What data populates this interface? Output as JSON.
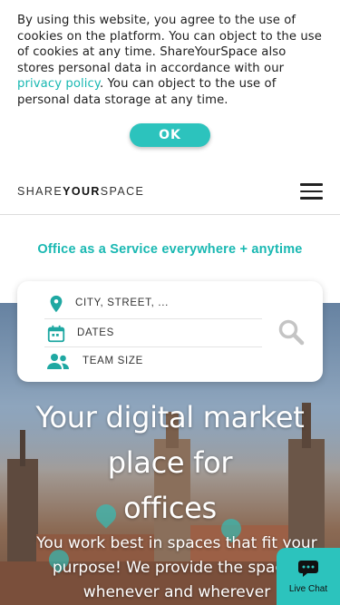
{
  "cookie": {
    "text_before_link": "By using this website, you agree to the use of cookies on the platform. You can object to the use of cookies at any time. ShareYourSpace also stores personal data in accordance with our ",
    "link_text": "privacy policy",
    "text_after_link": ". You can object to the use of personal data storage at any time.",
    "ok_label": "OK"
  },
  "header": {
    "logo_part1": "SHARE",
    "logo_part2": "YOUR",
    "logo_part3": "SPACE",
    "menu_icon": "hamburger-menu-icon"
  },
  "tagline": "Office as a Service everywhere + anytime",
  "search": {
    "location_placeholder": "CITY, STREET, ...",
    "dates_placeholder": "DATES",
    "team_placeholder": "TEAM SIZE",
    "location_icon": "map-pin-icon",
    "dates_icon": "calendar-icon",
    "team_icon": "team-icon",
    "search_icon": "search-icon"
  },
  "hero": {
    "title_line1": "Your digital market",
    "title_line2": "place for",
    "title_line3": "offices",
    "subtitle": "You work best in spaces that fit your purpose! We provide the spaces whenever and wherever"
  },
  "chat": {
    "label": "Live Chat",
    "icon": "chat-bubble-icon"
  },
  "colors": {
    "accent": "#2cc3bd",
    "link": "#19b8b2"
  }
}
